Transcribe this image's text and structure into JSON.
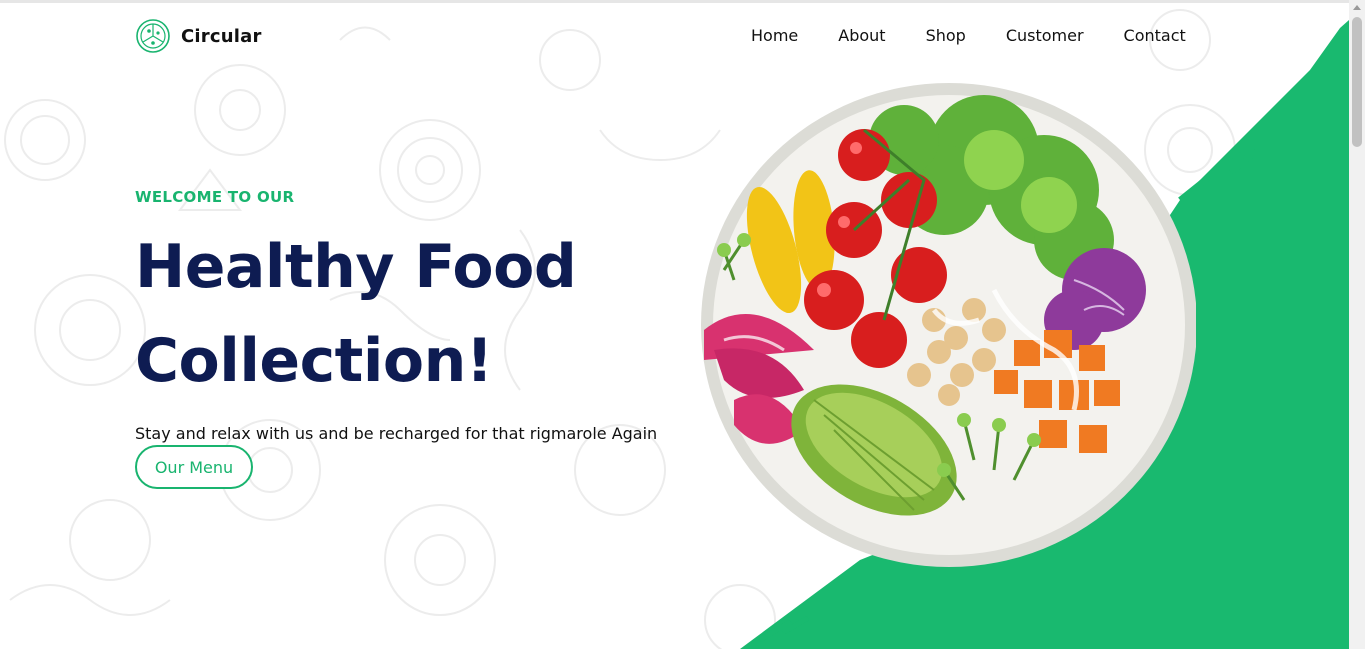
{
  "brand": {
    "name": "Circular",
    "icon": "pizza-icon"
  },
  "nav": {
    "items": [
      "Home",
      "About",
      "Shop",
      "Customer",
      "Contact"
    ]
  },
  "hero": {
    "eyebrow": "WELCOME TO OUR",
    "title_line1": "Healthy Food",
    "title_line2": "Collection!",
    "subtitle": "Stay and relax with us and be recharged for that rigmarole Again",
    "cta_label": "Our Menu"
  },
  "colors": {
    "accent": "#19b46f",
    "title": "#0e1c52",
    "text": "#111111",
    "background": "#ffffff"
  }
}
